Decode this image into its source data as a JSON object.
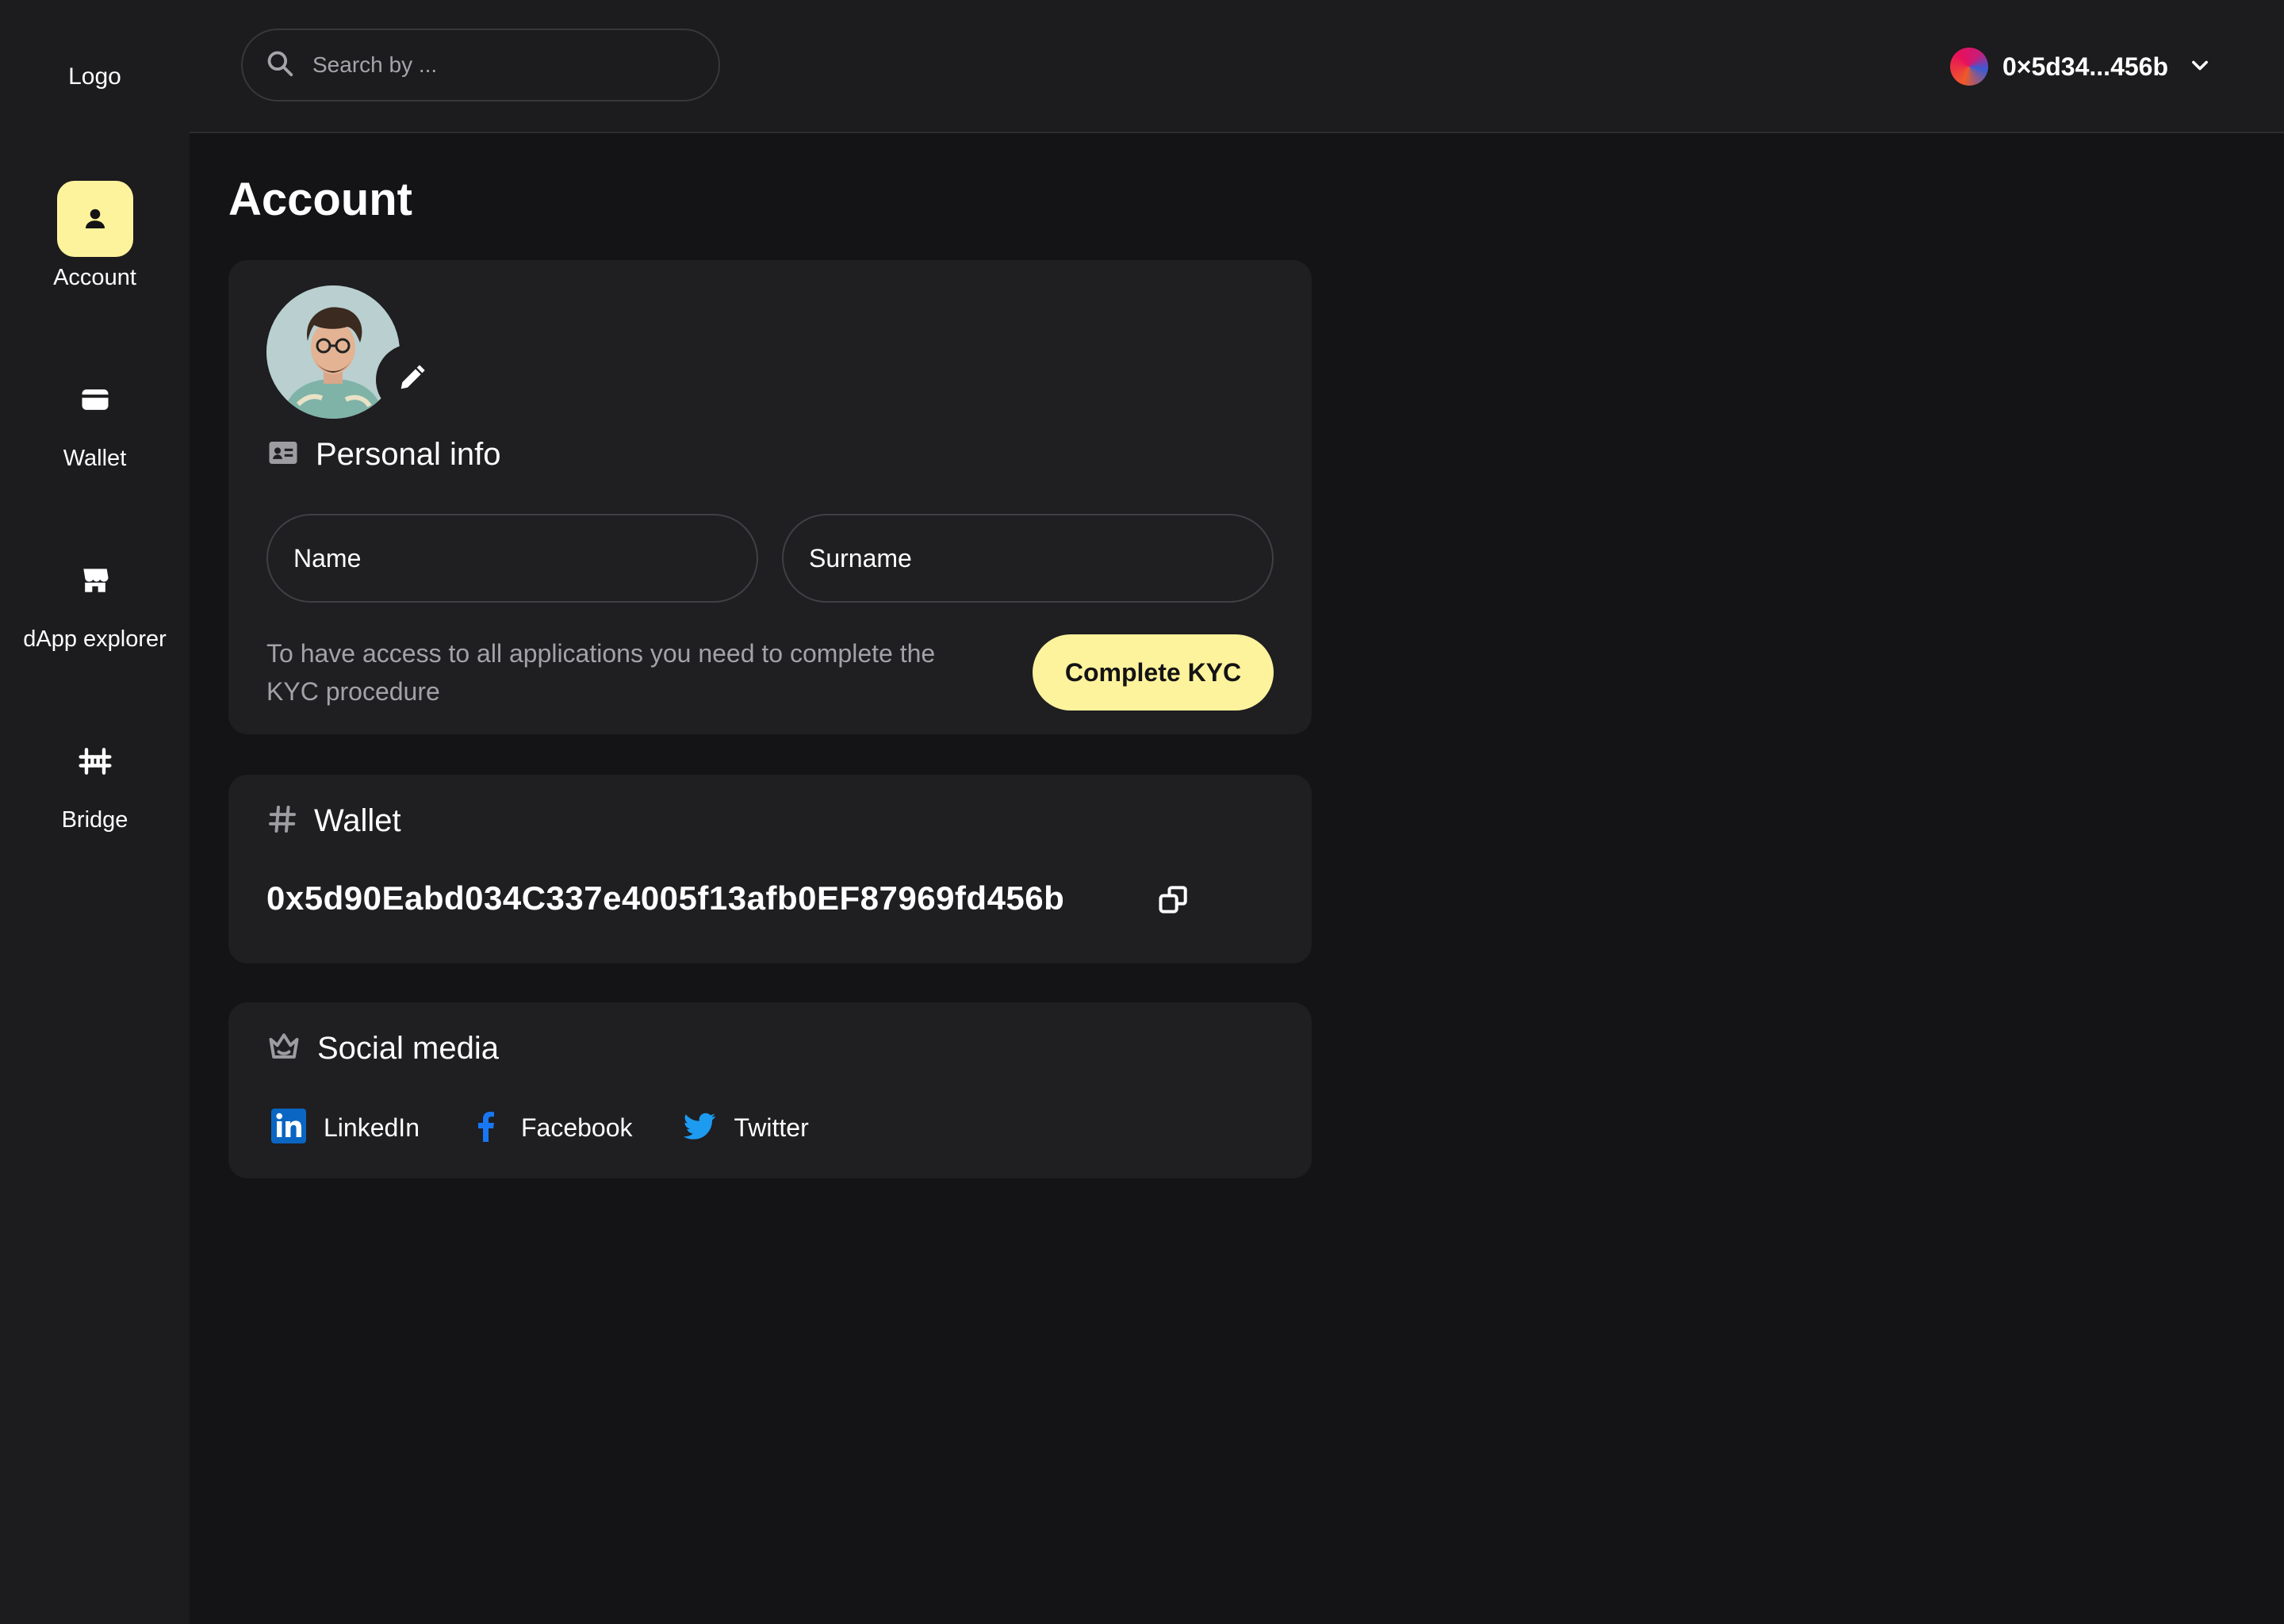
{
  "sidebar": {
    "logo": "Logo",
    "items": [
      {
        "label": "Account",
        "icon": "person-icon",
        "active": true
      },
      {
        "label": "Wallet",
        "icon": "wallet-icon",
        "active": false
      },
      {
        "label": "dApp explorer",
        "icon": "store-icon",
        "active": false
      },
      {
        "label": "Bridge",
        "icon": "bridge-icon",
        "active": false
      }
    ]
  },
  "header": {
    "search_placeholder": "Search by ...",
    "account_address": "0×5d34...456b"
  },
  "page": {
    "title": "Account"
  },
  "personal_info": {
    "title": "Personal info",
    "name_placeholder": "Name",
    "surname_placeholder": "Surname",
    "kyc_text": "To have access to all applications you need to complete the KYC procedure",
    "kyc_button": "Complete KYC"
  },
  "wallet": {
    "title": "Wallet",
    "address": "0x5d90Eabd034C337e4005f13afb0EF87969fd456b"
  },
  "social": {
    "title": "Social media",
    "links": [
      {
        "label": "LinkedIn",
        "icon": "linkedin-icon",
        "color": "#0a66c2"
      },
      {
        "label": "Facebook",
        "icon": "facebook-icon",
        "color": "#1877f2"
      },
      {
        "label": "Twitter",
        "icon": "twitter-icon",
        "color": "#1d9bf0"
      }
    ]
  },
  "colors": {
    "accent": "#fdf39c",
    "background": "#141315",
    "panel": "#1c1b1d",
    "card": "#1f1e21"
  }
}
